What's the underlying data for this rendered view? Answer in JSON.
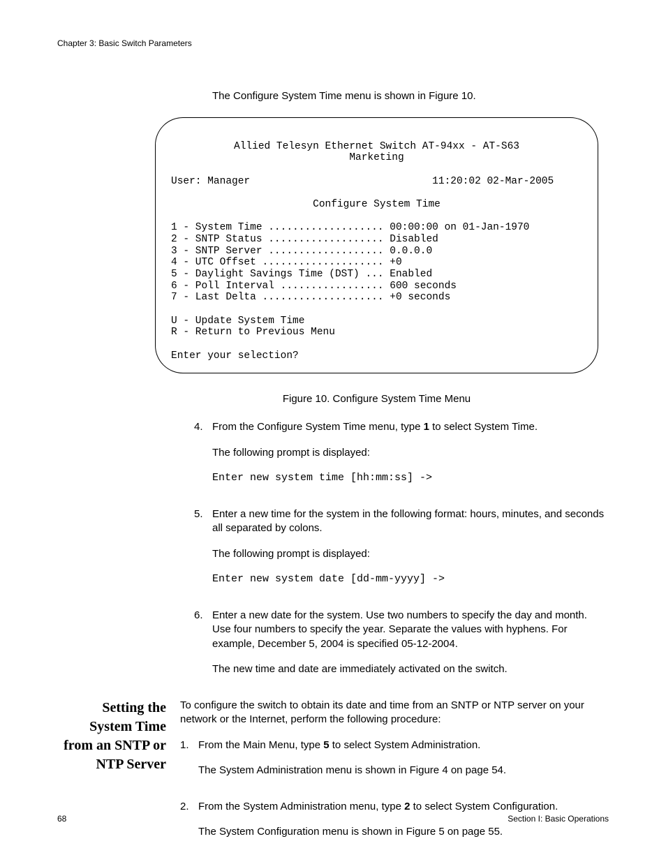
{
  "header": {
    "chapter": "Chapter 3: Basic Switch Parameters"
  },
  "intro": "The Configure System Time menu is shown in Figure 10.",
  "terminal": {
    "title1": "Allied Telesyn Ethernet Switch AT-94xx - AT-S63",
    "title2": "Marketing",
    "userline": "User: Manager                              11:20:02 02-Mar-2005",
    "menuTitle": "Configure System Time",
    "items": [
      "1 - System Time ................... 00:00:00 on 01-Jan-1970",
      "2 - SNTP Status ................... Disabled",
      "3 - SNTP Server ................... 0.0.0.0",
      "4 - UTC Offset .................... +0",
      "5 - Daylight Savings Time (DST) ... Enabled",
      "6 - Poll Interval ................. 600 seconds",
      "7 - Last Delta .................... +0 seconds"
    ],
    "u": "U - Update System Time",
    "r": "R - Return to Previous Menu",
    "prompt": "Enter your selection?"
  },
  "figureCaption": "Figure 10. Configure System Time Menu",
  "steps4": {
    "num": "4.",
    "line1a": "From the Configure System Time menu, type ",
    "bold1": "1",
    "line1b": " to select System Time.",
    "line2": "The following prompt is displayed:",
    "mono": "Enter new system time [hh:mm:ss] ->"
  },
  "steps5": {
    "num": "5.",
    "line1": "Enter a new time for the system in the following format: hours, minutes, and seconds all separated by colons.",
    "line2": "The following prompt is displayed:",
    "mono": "Enter new system date [dd-mm-yyyy] ->"
  },
  "steps6": {
    "num": "6.",
    "line1": "Enter a new date for the system. Use two numbers to specify the day and month. Use four numbers to specify the year. Separate the values with hyphens. For example, December 5, 2004 is specified 05-12-2004.",
    "line2": "The new time and date are immediately activated on the switch."
  },
  "sideHeading": "Setting the System Time from an SNTP or NTP Server",
  "sideIntro": "To configure the switch to obtain its date and time from an SNTP or NTP server on your network or the Internet, perform the following procedure:",
  "serverSteps1": {
    "num": "1.",
    "line1a": "From the Main Menu, type ",
    "bold1": "5",
    "line1b": " to select System Administration.",
    "line2": "The System Administration menu is shown in Figure 4 on page 54."
  },
  "serverSteps2": {
    "num": "2.",
    "line1a": "From the System Administration menu, type ",
    "bold1": "2",
    "line1b": " to select System Configuration.",
    "line2": "The System Configuration menu is shown in Figure 5 on page 55."
  },
  "footer": {
    "pageNum": "68",
    "section": "Section I: Basic Operations"
  }
}
